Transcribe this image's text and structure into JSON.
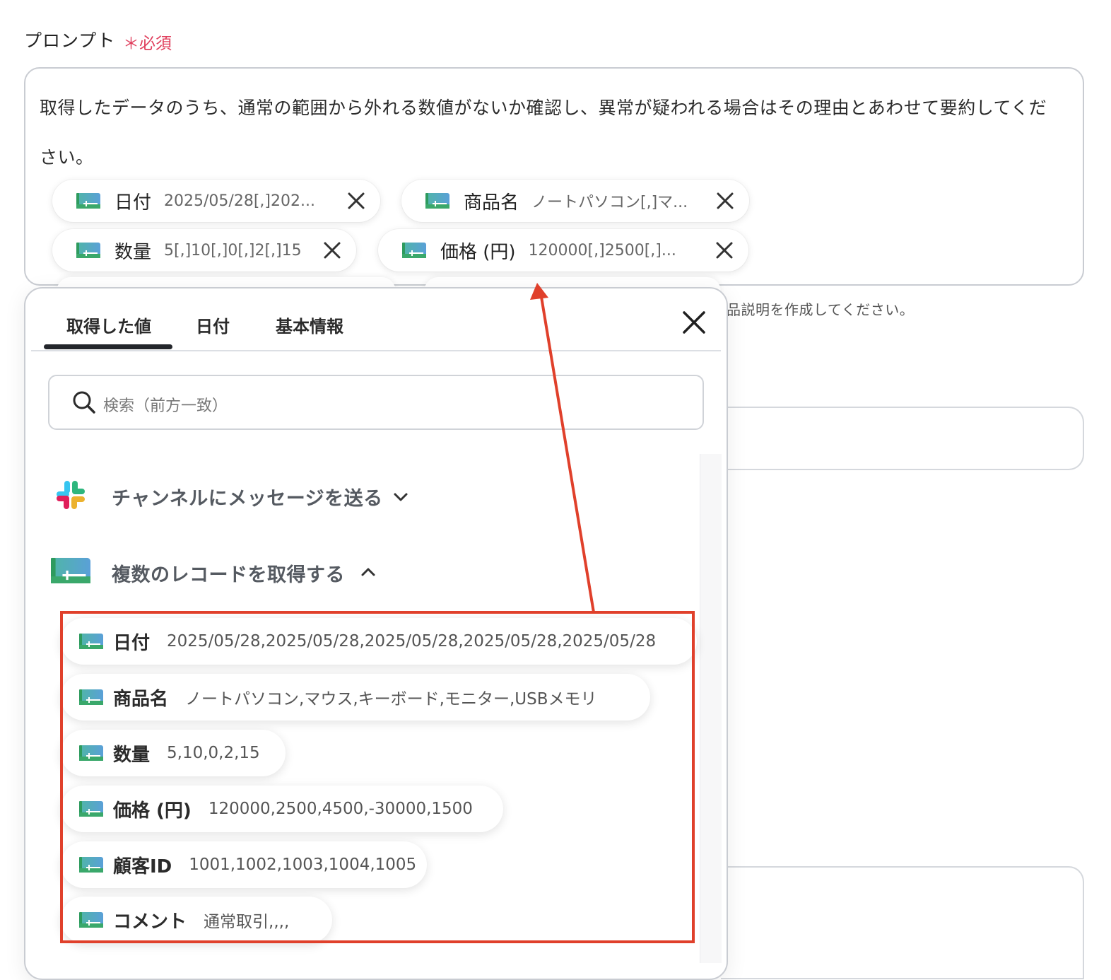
{
  "field": {
    "label": "プロンプト",
    "required": "＊必須"
  },
  "prompt": {
    "text": "取得したデータのうち、通常の範囲から外れる数値がないか確認し、異常が疑われる場合はその理由とあわせて要約してください。",
    "pills": [
      {
        "name": "日付",
        "value": "2025/05/28[,]202..."
      },
      {
        "name": "商品名",
        "value": "ノートパソコン[,]マ..."
      },
      {
        "name": "数量",
        "value": "5[,]10[,]0[,]2[,]15"
      },
      {
        "name": "価格 (円)",
        "value": "120000[,]2500[,]..."
      }
    ]
  },
  "helper_text": "品説明を作成してください。",
  "popup": {
    "tabs": [
      "取得した値",
      "日付",
      "基本情報"
    ],
    "active_tab": 0,
    "search_placeholder": "検索（前方一致）",
    "sections": [
      {
        "title": "チャンネルにメッセージを送る",
        "icon": "slack-icon",
        "expanded": false
      },
      {
        "title": "複数のレコードを取得する",
        "icon": "sheet-icon",
        "expanded": true
      }
    ],
    "items": [
      {
        "name": "日付",
        "value": "2025/05/28,2025/05/28,2025/05/28,2025/05/28,2025/05/28"
      },
      {
        "name": "商品名",
        "value": "ノートパソコン,マウス,キーボード,モニター,USBメモリ"
      },
      {
        "name": "数量",
        "value": "5,10,0,2,15"
      },
      {
        "name": "価格 (円)",
        "value": "120000,2500,4500,-30000,1500"
      },
      {
        "name": "顧客ID",
        "value": "1001,1002,1003,1004,1005"
      },
      {
        "name": "コメント",
        "value": "通常取引,,,,"
      }
    ]
  },
  "colors": {
    "required": "#e0405e",
    "highlight": "#e0402b",
    "icon_green": "#3aa86b",
    "icon_blue": "#5aa8d6"
  }
}
